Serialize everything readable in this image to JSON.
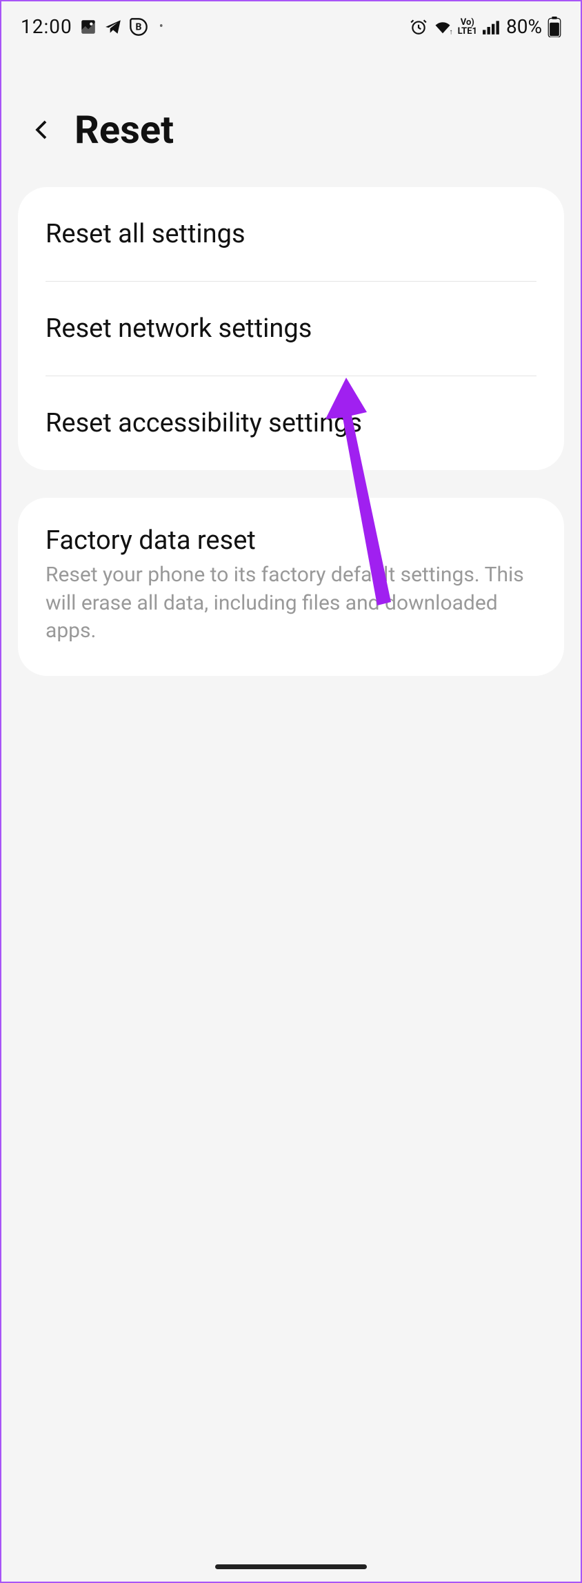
{
  "status_bar": {
    "time": "12:00",
    "battery_percent": "80%"
  },
  "header": {
    "title": "Reset"
  },
  "reset_options": {
    "item_0": "Reset all settings",
    "item_1": "Reset network settings",
    "item_2": "Reset accessibility settings"
  },
  "factory_reset": {
    "title": "Factory data reset",
    "description": "Reset your phone to its factory default settings. This will erase all data, including files and downloaded apps."
  }
}
